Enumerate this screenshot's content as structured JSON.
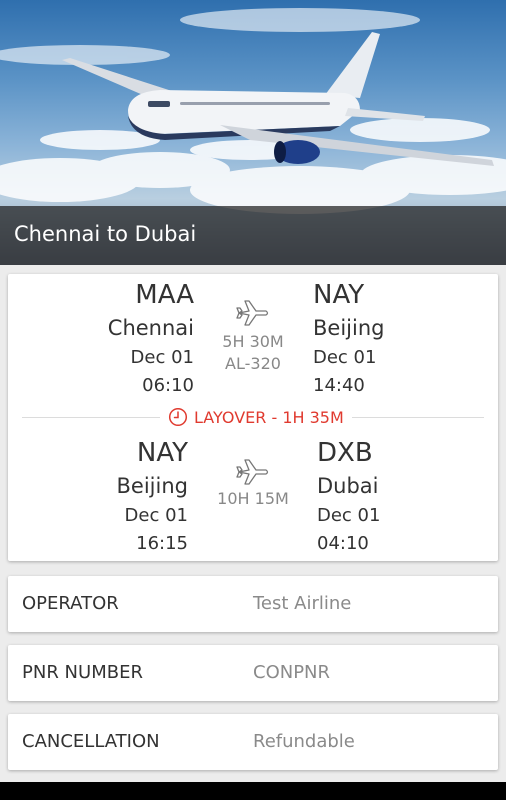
{
  "header": {
    "title": "Chennai to Dubai"
  },
  "segments": [
    {
      "from": {
        "code": "MAA",
        "city": "Chennai",
        "date": "Dec 01",
        "time": "06:10"
      },
      "to": {
        "code": "NAY",
        "city": "Beijing",
        "date": "Dec 01",
        "time": "14:40"
      },
      "duration": "5H 30M",
      "aircraft": "AL-320"
    },
    {
      "from": {
        "code": "NAY",
        "city": "Beijing",
        "date": "Dec 01",
        "time": "16:15"
      },
      "to": {
        "code": "DXB",
        "city": "Dubai",
        "date": "Dec 01",
        "time": "04:10"
      },
      "duration": "10H 15M"
    }
  ],
  "layover": {
    "label": "LAYOVER - 1H 35M",
    "icon": "clock-icon"
  },
  "details": [
    {
      "key": "OPERATOR",
      "value": "Test Airline"
    },
    {
      "key": "PNR NUMBER",
      "value": "CONPNR"
    },
    {
      "key": "CANCELLATION",
      "value": "Refundable"
    }
  ],
  "colors": {
    "accent_red": "#e03a2f",
    "muted_text": "#8a8a8a",
    "header_overlay": "#1e1e1e",
    "background": "#ececec"
  }
}
